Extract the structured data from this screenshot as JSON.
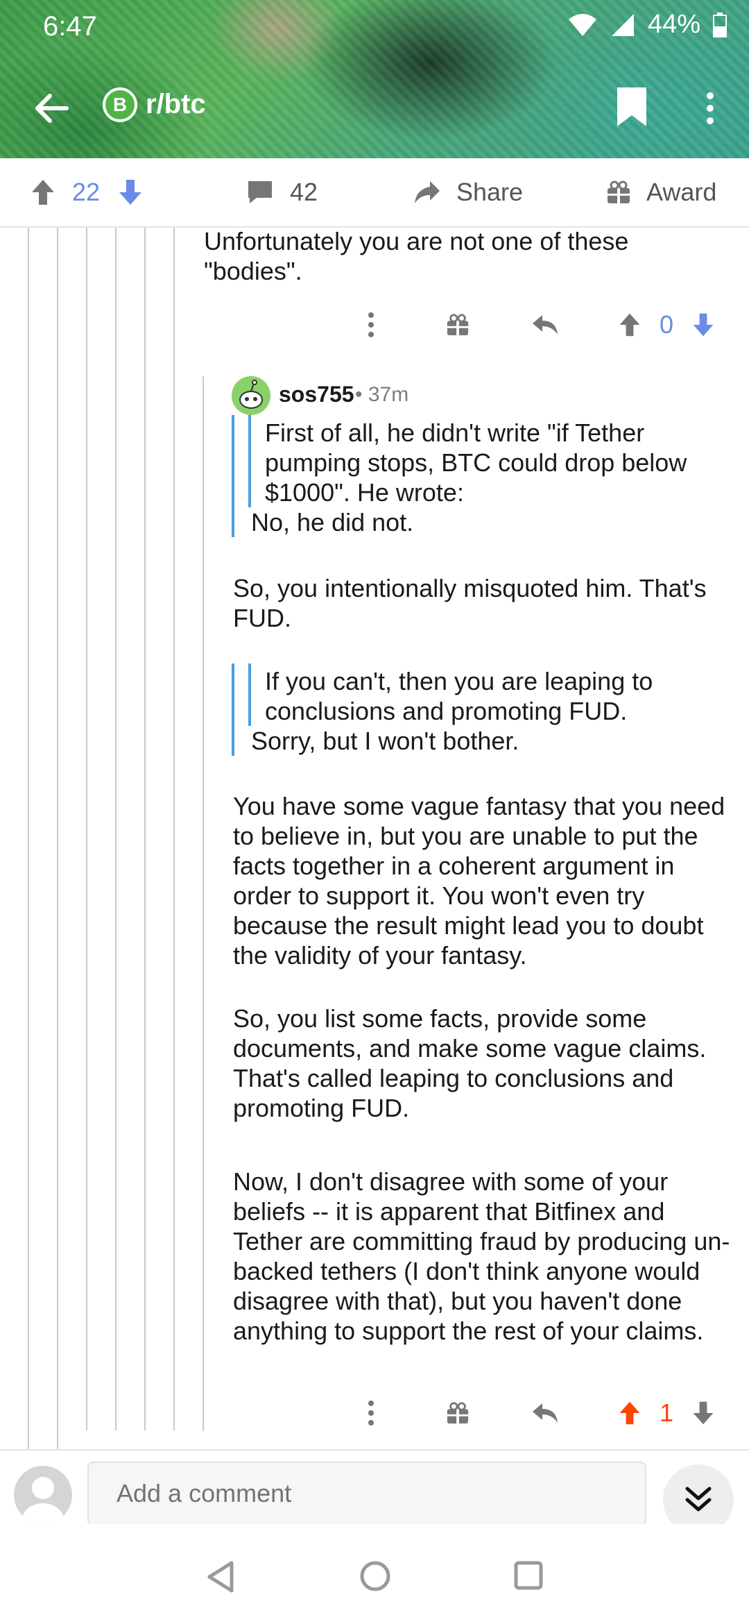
{
  "status": {
    "time": "6:47",
    "battery": "44%"
  },
  "header": {
    "subreddit": "r/btc",
    "badge_symbol": "B"
  },
  "action_bar": {
    "score": "22",
    "comments": "42",
    "share_label": "Share",
    "award_label": "Award"
  },
  "parent_comment": {
    "text": "Unfortunately you are not one of these \"bodies\".",
    "score": "0"
  },
  "reply": {
    "author": "sos755",
    "age": "• 37m",
    "quote1": "First of all, he didn't write \"if Tether pumping stops, BTC could drop below $1000\". He wrote:",
    "quote1_tail": "No, he did not.",
    "para1": "So, you intentionally misquoted him. That's FUD.",
    "quote2": "If you can't, then you are leaping to conclusions and promoting FUD.",
    "quote2_tail": "Sorry, but I won't bother.",
    "para2": "You have some vague fantasy that you need to believe in, but you are unable to put the facts together in a coherent argument in order to support it. You won't even try because the result might lead you to doubt the validity of your fantasy.",
    "para3": "So, you list some facts, provide some documents, and make some vague claims. That's called leaping to conclusions and promoting FUD.",
    "para4": "Now, I don't disagree with some of your beliefs -- it is apparent that Bitfinex and Tether are committing fraud by producing un-backed tethers (I don't think anyone would disagree with that), but you haven't done anything to support the rest of your claims.",
    "score": "1"
  },
  "bottom_bar": {
    "placeholder": "Add a comment"
  },
  "colors": {
    "upvoted": "#ff4500",
    "downvote_blue": "#6a8be7",
    "quote_bar": "#4a9fe0",
    "thread_line": "#c9c9c9"
  }
}
